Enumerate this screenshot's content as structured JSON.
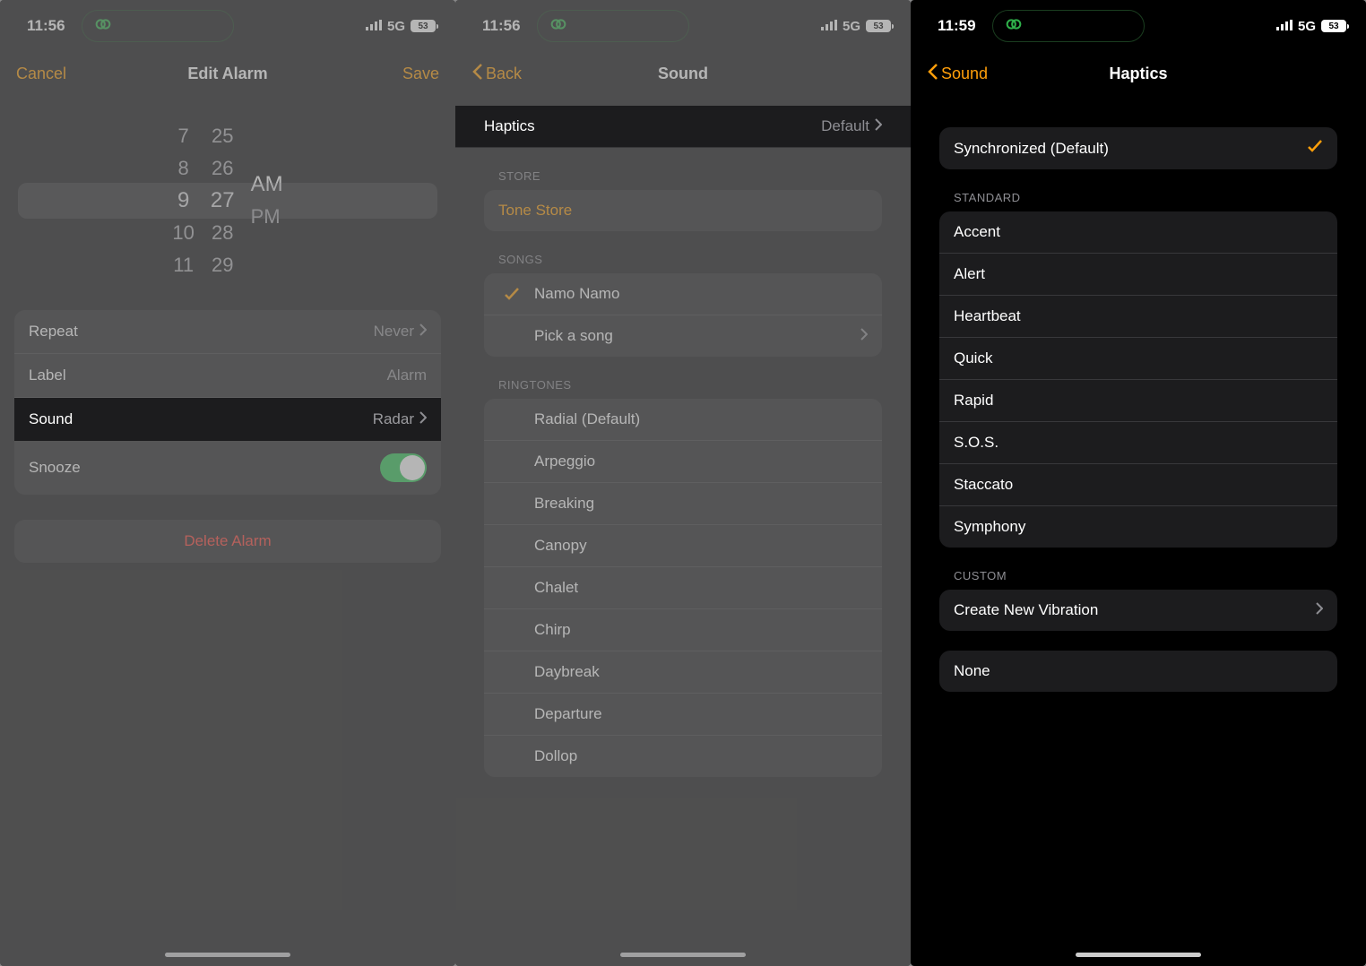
{
  "screen1": {
    "status_time": "11:56",
    "status_net": "5G",
    "status_batt": "53",
    "nav_left": "Cancel",
    "nav_title": "Edit Alarm",
    "nav_right": "Save",
    "picker_hours": [
      "7",
      "8",
      "9",
      "10",
      "11"
    ],
    "picker_mins": [
      "25",
      "26",
      "27",
      "28",
      "29"
    ],
    "picker_ampm": [
      "AM",
      "PM"
    ],
    "rows": {
      "repeat": {
        "label": "Repeat",
        "value": "Never"
      },
      "label": {
        "label": "Label",
        "value": "Alarm"
      },
      "sound": {
        "label": "Sound",
        "value": "Radar"
      },
      "snooze": {
        "label": "Snooze"
      }
    },
    "delete": "Delete Alarm"
  },
  "screen2": {
    "status_time": "11:56",
    "status_net": "5G",
    "status_batt": "53",
    "nav_back": "Back",
    "nav_title": "Sound",
    "haptics": {
      "label": "Haptics",
      "value": "Default"
    },
    "store_header": "STORE",
    "tone_store": "Tone Store",
    "songs_header": "SONGS",
    "song_selected": "Namo Namo",
    "pick_song": "Pick a song",
    "ringtones_header": "RINGTONES",
    "ringtones": [
      "Radial (Default)",
      "Arpeggio",
      "Breaking",
      "Canopy",
      "Chalet",
      "Chirp",
      "Daybreak",
      "Departure",
      "Dollop"
    ]
  },
  "screen3": {
    "status_time": "11:59",
    "status_net": "5G",
    "status_batt": "53",
    "nav_back": "Sound",
    "nav_title": "Haptics",
    "default_row": "Synchronized (Default)",
    "standard_header": "STANDARD",
    "standard": [
      "Accent",
      "Alert",
      "Heartbeat",
      "Quick",
      "Rapid",
      "S.O.S.",
      "Staccato",
      "Symphony"
    ],
    "custom_header": "CUSTOM",
    "create": "Create New Vibration",
    "none": "None"
  }
}
